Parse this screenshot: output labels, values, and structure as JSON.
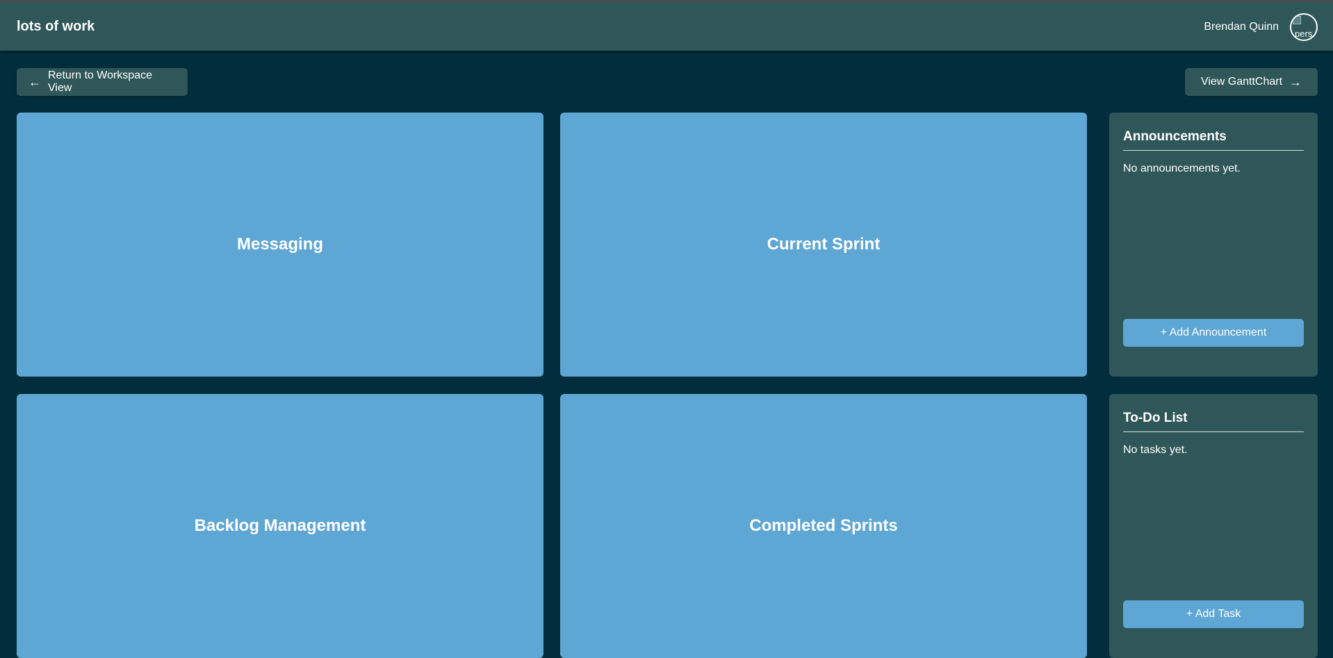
{
  "header": {
    "title": "lots of work",
    "user_name": "Brendan Quinn",
    "avatar_alt": "pers"
  },
  "nav": {
    "return_label": "Return to Workspace View",
    "gantt_label": "View GanttChart"
  },
  "cards": {
    "messaging": "Messaging",
    "current_sprint": "Current Sprint",
    "backlog": "Backlog Management",
    "completed_sprints": "Completed Sprints"
  },
  "announcements": {
    "title": "Announcements",
    "empty_text": "No announcements yet.",
    "add_label": "+ Add Announcement"
  },
  "todo": {
    "title": "To-Do List",
    "empty_text": "No tasks yet.",
    "add_label": "+ Add Task"
  },
  "icons": {
    "back": "arrow-left-icon",
    "forward": "arrow-right-icon"
  },
  "colors": {
    "background": "#012d3c",
    "panel": "#2f5659",
    "card": "#5ea6d4"
  }
}
